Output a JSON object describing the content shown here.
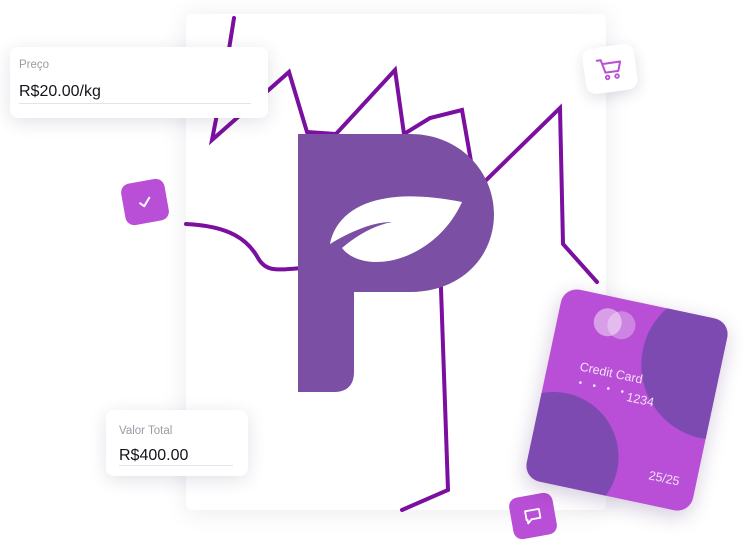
{
  "price_card": {
    "label": "Preço",
    "value": "R$20.00/kg"
  },
  "total_card": {
    "label": "Valor Total",
    "value": "R$400.00"
  },
  "credit_card": {
    "title": "Credit Card",
    "masked_dots": "• • • •",
    "last_digits": "1234",
    "expiry": "25/25"
  },
  "icons": {
    "logo": "leaf-p-logo-icon",
    "check": "check-icon",
    "cart": "shopping-cart-icon",
    "chat": "chat-bubble-icon"
  },
  "colors": {
    "brand_purple": "#7b4fa3",
    "line_purple": "#7a0fa0",
    "accent_magenta": "#b84fd6",
    "card_dark": "#7c4ab0"
  }
}
